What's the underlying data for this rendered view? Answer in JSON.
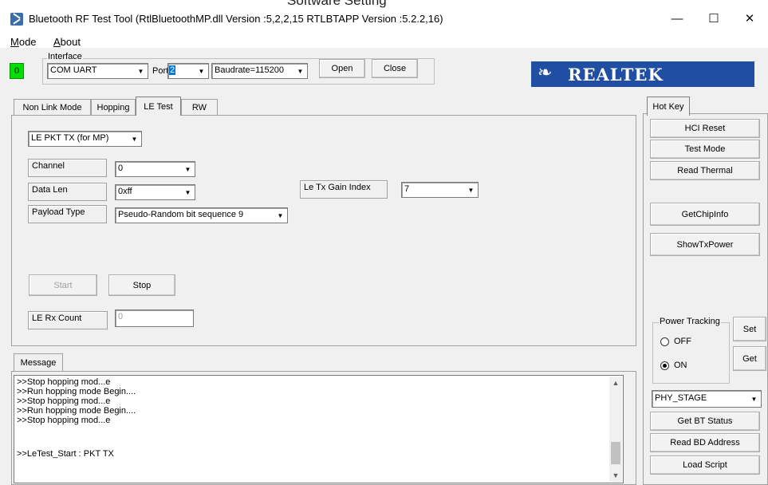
{
  "window": {
    "top_cut_text": "Software Setting",
    "title": "Bluetooth RF Test Tool (RtlBluetoothMP.dll Version :5,2,2,15   RTLBTAPP Version :5.2.2,16)",
    "minimize_glyph": "—",
    "maximize_glyph": "☐",
    "close_glyph": "✕"
  },
  "menu": {
    "mode_first": "M",
    "mode_rest": "ode",
    "about_first": "A",
    "about_rest": "bout"
  },
  "status_led": "0",
  "interface": {
    "legend": "Interface",
    "type": "COM UART",
    "port_label": "Port",
    "port": "2",
    "baudrate": "Baudrate=115200",
    "open_label": "Open",
    "close_label": "Close"
  },
  "logo": {
    "text": "REALTEK",
    "color": "#1f4ea3"
  },
  "tabs": [
    "Non Link Mode",
    "Hopping",
    "LE Test",
    "RW"
  ],
  "active_tab": "LE Test",
  "le_test": {
    "mode": "LE PKT TX (for MP)",
    "channel_label": "Channel",
    "channel": "0",
    "data_len_label": "Data Len",
    "data_len": "0xff",
    "payload_type_label": "Payload Type",
    "payload_type": "Pseudo-Random bit sequence 9",
    "gain_label": "Le Tx Gain Index",
    "gain": "7",
    "start_label": "Start",
    "stop_label": "Stop",
    "rx_count_label": "LE Rx Count",
    "rx_count": "0"
  },
  "hotkey": {
    "tab": "Hot Key",
    "hci_reset": "HCI Reset",
    "test_mode": "Test Mode",
    "read_thermal": "Read Thermal",
    "get_chip_info": "GetChipInfo",
    "show_tx_power": "ShowTxPower",
    "power_tracking": "Power Tracking",
    "off": "OFF",
    "on": "ON",
    "power_tracking_selected": "ON",
    "set": "Set",
    "get": "Get",
    "stage": "PHY_STAGE",
    "get_bt_status": "Get BT Status",
    "read_bd_address": "Read BD Address",
    "load_script": "Load Script"
  },
  "message": {
    "tab": "Message",
    "lines": [
      ">>Stop hopping mod...e",
      ">>Run hopping mode Begin....",
      ">>Stop hopping mod...e",
      ">>Run hopping mode Begin....",
      ">>Stop hopping mod...e",
      "",
      ">>LeTest_Start : PKT TX"
    ]
  }
}
